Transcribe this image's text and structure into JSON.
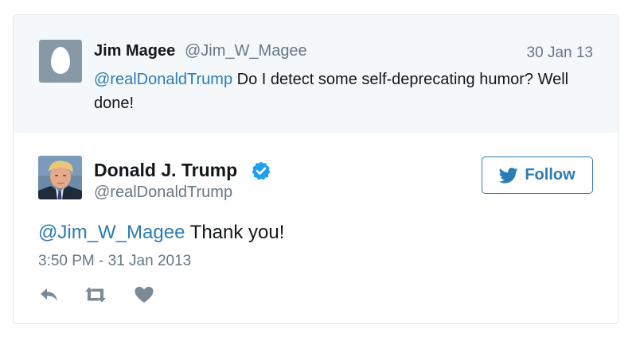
{
  "parent_tweet": {
    "name": "Jim Magee",
    "handle": "@Jim_W_Magee",
    "date": "30 Jan 13",
    "mention": "@realDonaldTrump",
    "text": " Do I detect some self-deprecating humor? Well done!"
  },
  "main_tweet": {
    "name": "Donald J. Trump",
    "handle": "@realDonaldTrump",
    "follow_label": "Follow",
    "mention": "@Jim_W_Magee",
    "text": " Thank you!",
    "timestamp": "3:50 PM - 31 Jan 2013"
  },
  "colors": {
    "link": "#2b7bb9",
    "secondary_text": "#657786",
    "parent_bg": "#f5f8fa",
    "verified": "#1da1f2"
  },
  "icons": {
    "reply": "reply-icon",
    "retweet": "retweet-icon",
    "like": "heart-icon"
  }
}
